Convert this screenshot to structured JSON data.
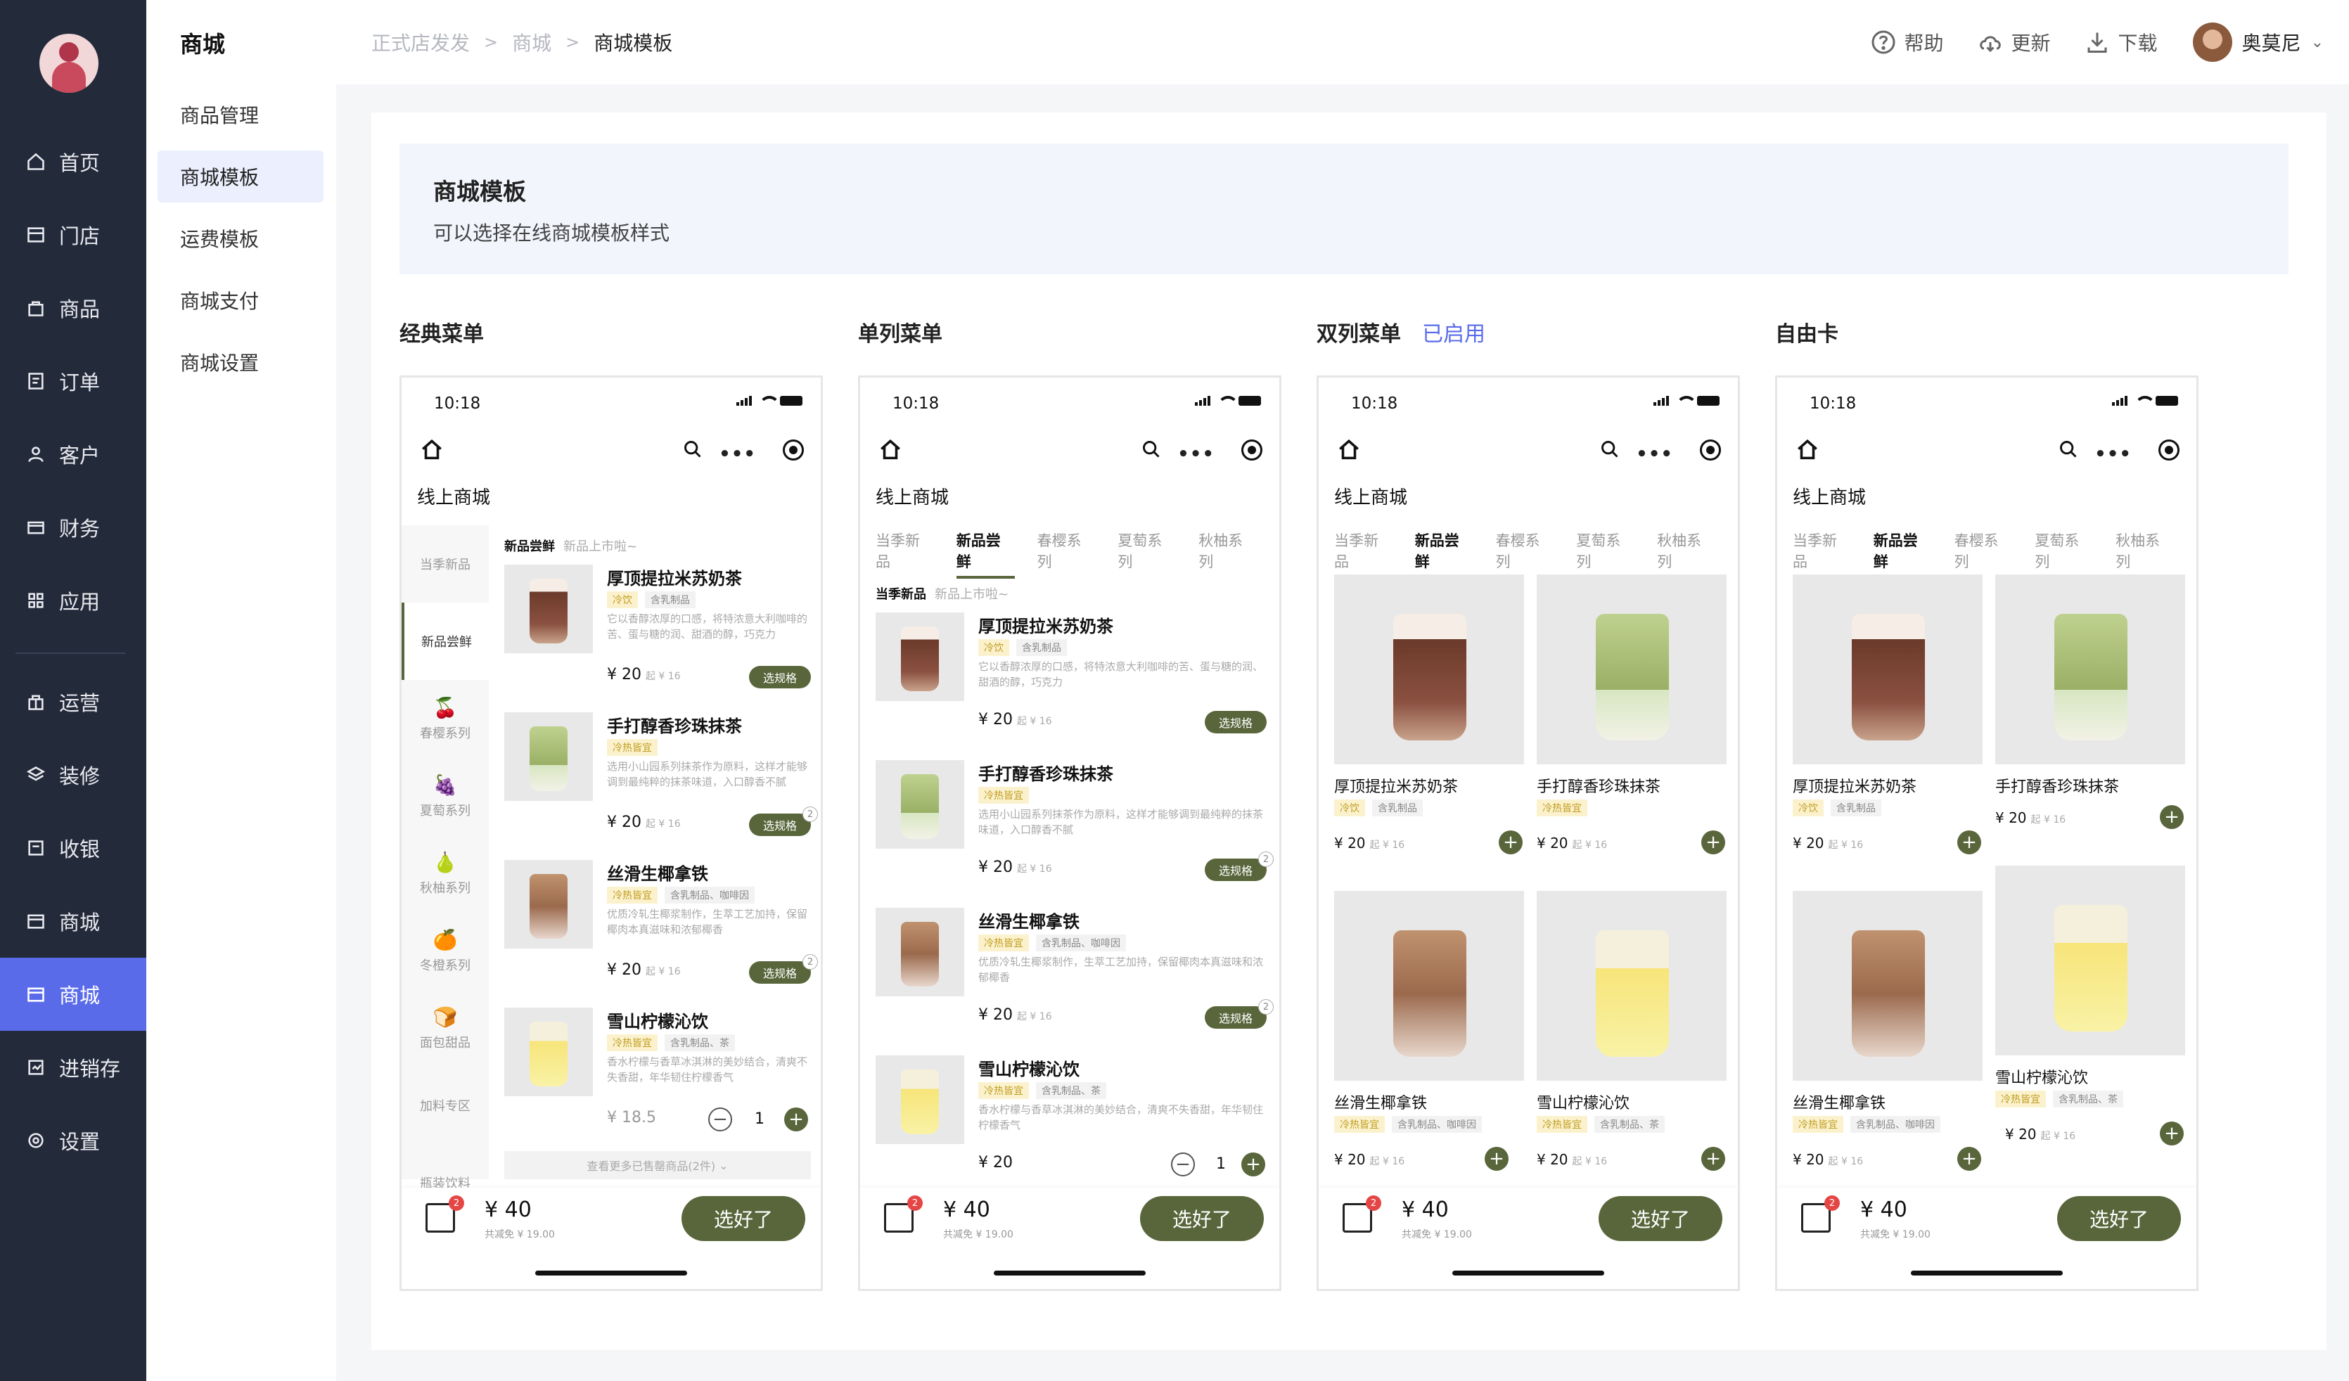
{
  "sidebar": {
    "items": [
      {
        "label": "首页",
        "icon": "home-icon"
      },
      {
        "label": "门店",
        "icon": "store-icon"
      },
      {
        "label": "商品",
        "icon": "bag-icon"
      },
      {
        "label": "订单",
        "icon": "order-icon"
      },
      {
        "label": "客户",
        "icon": "user-icon"
      },
      {
        "label": "财务",
        "icon": "wallet-icon"
      },
      {
        "label": "应用",
        "icon": "grid-icon"
      },
      {
        "label": "运营",
        "icon": "gift-icon"
      },
      {
        "label": "装修",
        "icon": "layers-icon"
      },
      {
        "label": "收银",
        "icon": "cashier-icon"
      },
      {
        "label": "商城",
        "icon": "mall-icon"
      },
      {
        "label": "商城",
        "icon": "mall-icon"
      },
      {
        "label": "进销存",
        "icon": "inventory-icon"
      },
      {
        "label": "设置",
        "icon": "gear-icon"
      }
    ]
  },
  "subnav": {
    "title": "商城",
    "items": [
      "商品管理",
      "商城模板",
      "运费模板",
      "商城支付",
      "商城设置"
    ]
  },
  "header": {
    "breadcrumb": [
      "正式店发发",
      "商城",
      "商城模板"
    ],
    "help": "帮助",
    "update": "更新",
    "download": "下载",
    "user": "奥莫尼"
  },
  "banner": {
    "title": "商城模板",
    "desc": "可以选择在线商城模板样式"
  },
  "templates": [
    {
      "title": "经典菜单",
      "status": ""
    },
    {
      "title": "单列菜单",
      "status": ""
    },
    {
      "title": "双列菜单",
      "status": "已启用"
    },
    {
      "title": "自由卡",
      "status": ""
    }
  ],
  "phone": {
    "time": "10:18",
    "shop": "线上商城",
    "tabs": [
      "当季新品",
      "新品尝鲜",
      "春樱系列",
      "夏萄系列",
      "秋柚系列"
    ],
    "vcats": [
      "当季新品",
      "新品尝鲜",
      "春樱系列",
      "夏萄系列",
      "秋柚系列",
      "冬橙系列",
      "面包甜品",
      "加料专区",
      "瓶装饮料"
    ],
    "sec1": "新品尝鲜",
    "sec1sub": "新品上市啦~",
    "sec2": "当季新品",
    "sec2sub": "新品上市啦~",
    "spec": "选规格",
    "more": "查看更多已售罄商品(2件)",
    "total": "¥ 40",
    "discount": "共减免 ¥ 19.00",
    "cta": "选好了",
    "cart": "2",
    "products": [
      {
        "name": "厚顶提拉米苏奶茶",
        "tags": [
          "冷饮",
          "含乳制品"
        ],
        "desc": "它以香醇浓厚的口感，将特浓意大利咖啡的苦、蛋与糖的润、甜酒的醇，巧克力",
        "price": "¥ 20",
        "sub": "起 ¥ 16"
      },
      {
        "name": "手打醇香珍珠抹茶",
        "tags": [
          "冷热皆宜"
        ],
        "desc": "选用小山园系列抹茶作为原料，这样才能够调到最纯粹的抹茶味道，入口醇香不腻",
        "price": "¥ 20",
        "sub": "起 ¥ 16",
        "badge": "2"
      },
      {
        "name": "丝滑生椰拿铁",
        "tags": [
          "冷热皆宜",
          "含乳制品、咖啡因"
        ],
        "desc": "优质冷轧生椰浆制作，生萃工艺加持，保留椰肉本真滋味和浓郁椰香",
        "price": "¥ 20",
        "sub": "起 ¥ 16",
        "badge": "2"
      },
      {
        "name": "雪山柠檬沁饮",
        "tags": [
          "冷热皆宜",
          "含乳制品、茶"
        ],
        "desc": "香水柠檬与香草冰淇淋的美妙结合，清爽不失香甜，年华韧住柠檬香气",
        "price": "¥ 18.5",
        "price2": "¥ 20",
        "qty": "1"
      }
    ]
  }
}
